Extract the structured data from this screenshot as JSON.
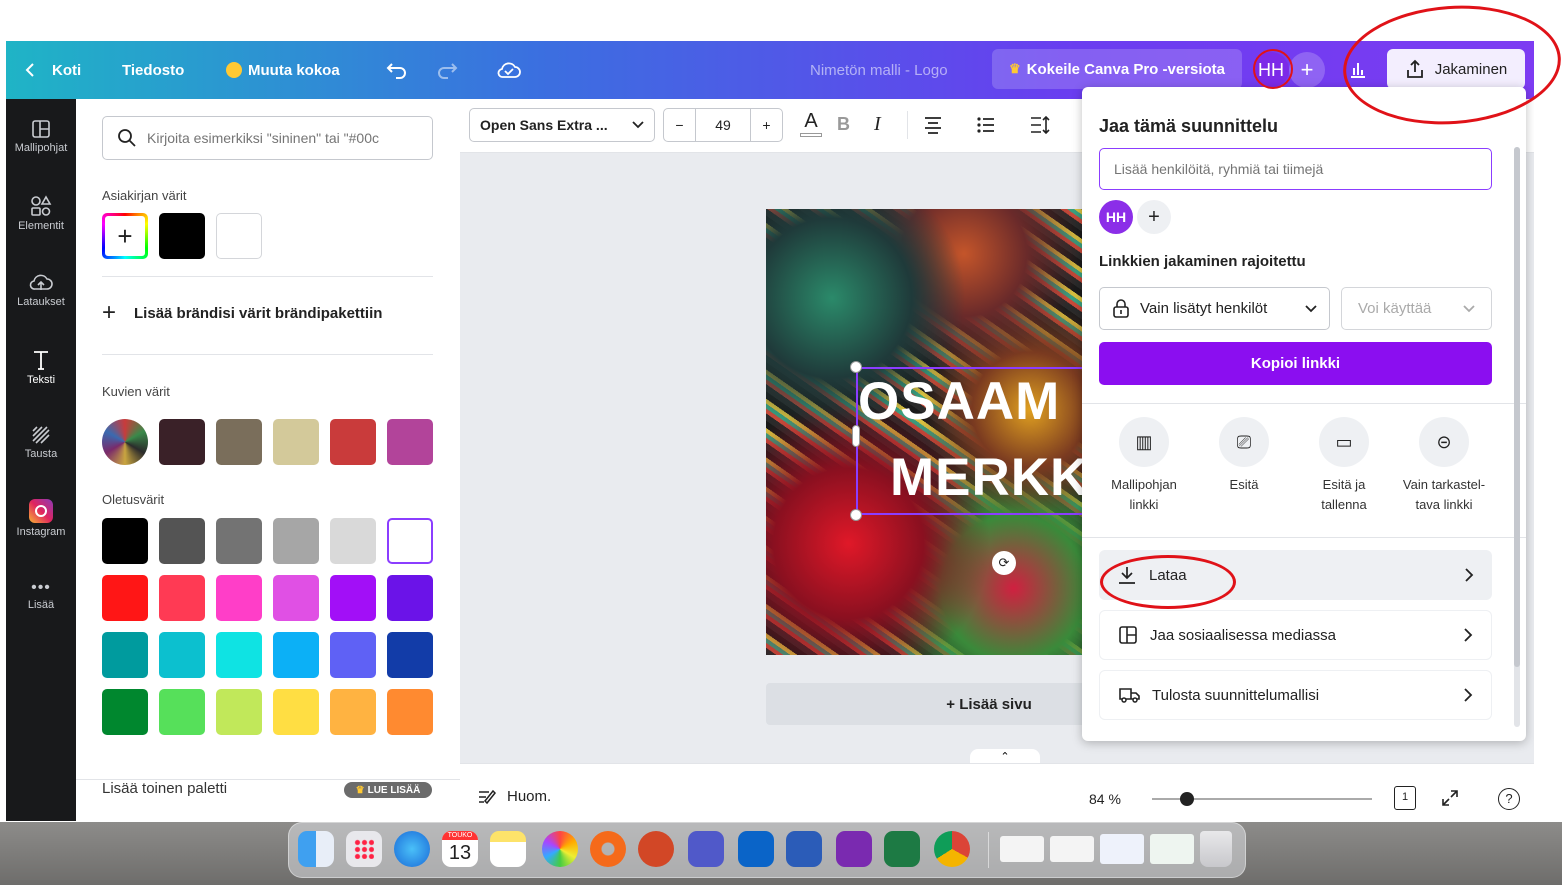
{
  "topbar": {
    "home": "Koti",
    "file": "Tiedosto",
    "resize": "Muuta kokoa",
    "title": "Nimetön malli - Logo",
    "try_pro": "Kokeile Canva Pro -versiota",
    "avatar": "HH",
    "share": "Jakaminen"
  },
  "rail": [
    {
      "label": "Mallipohjat",
      "icon": "template-icon"
    },
    {
      "label": "Elementit",
      "icon": "elements-icon"
    },
    {
      "label": "Lataukset",
      "icon": "upload-icon"
    },
    {
      "label": "Teksti",
      "icon": "text-icon"
    },
    {
      "label": "Tausta",
      "icon": "background-icon"
    },
    {
      "label": "Instagram",
      "icon": "instagram-icon"
    },
    {
      "label": "Lisää",
      "icon": "more-icon"
    }
  ],
  "panel": {
    "search_placeholder": "Kirjoita esimerkiksi \"sininen\" tai \"#00c",
    "doc_colors_title": "Asiakirjan värit",
    "add_brand": "Lisää brändisi värit brändipakettiin",
    "image_colors_title": "Kuvien värit",
    "default_colors_title": "Oletusvärit",
    "another_palette": "Lisää toinen paletti",
    "read_more": "LUE LISÄÄ",
    "doc_colors": [
      "#000000",
      "#ffffff"
    ],
    "image_colors": [
      "#3a2128",
      "#7a6e5b",
      "#d3c99a",
      "#c93b3b",
      "#b2449a"
    ],
    "default_colors": [
      "#000000",
      "#545454",
      "#737373",
      "#a6a6a6",
      "#d9d9d9",
      "#ffffff",
      "#ff1616",
      "#ff3a54",
      "#ff3ec8",
      "#e050e4",
      "#a20ff7",
      "#6b13e8",
      "#009b9e",
      "#0cc0cf",
      "#0fe3e3",
      "#0cb0f6",
      "#5f61f5",
      "#123ca8",
      "#00872e",
      "#56e05a",
      "#c1e85a",
      "#ffde43",
      "#ffb341",
      "#ff8a30"
    ]
  },
  "toolbar": {
    "font": "Open Sans Extra ...",
    "size": "49",
    "minus": "−",
    "plus": "+"
  },
  "canvas": {
    "line1": "OSAAM",
    "line2": "MERKK",
    "add_page": "+ Lisää sivu"
  },
  "footer": {
    "notes": "Huom.",
    "zoom": "84 %",
    "page": "1",
    "help": "?"
  },
  "share": {
    "title": "Jaa tämä suunnittelu",
    "input_placeholder": "Lisää henkilöitä, ryhmiä tai tiimejä",
    "avatar": "HH",
    "link_title": "Linkkien jakaminen rajoitettu",
    "access": "Vain lisätyt henkilöt",
    "permission": "Voi käyttää",
    "copy": "Kopioi linkki",
    "options": [
      {
        "l1": "Mallipohjan",
        "l2": "linkki",
        "icon": "template-link-icon"
      },
      {
        "l1": "Esitä",
        "l2": "",
        "icon": "present-icon"
      },
      {
        "l1": "Esitä ja",
        "l2": "tallenna",
        "icon": "record-icon"
      },
      {
        "l1": "Vain tarkastel-",
        "l2": "tava linkki",
        "icon": "view-link-icon"
      }
    ],
    "download": "Lataa",
    "social": "Jaa sosiaalisessa mediassa",
    "print": "Tulosta suunnittelumallisi"
  },
  "dock": {
    "calendar_month": "TOUKO",
    "calendar_day": "13"
  }
}
